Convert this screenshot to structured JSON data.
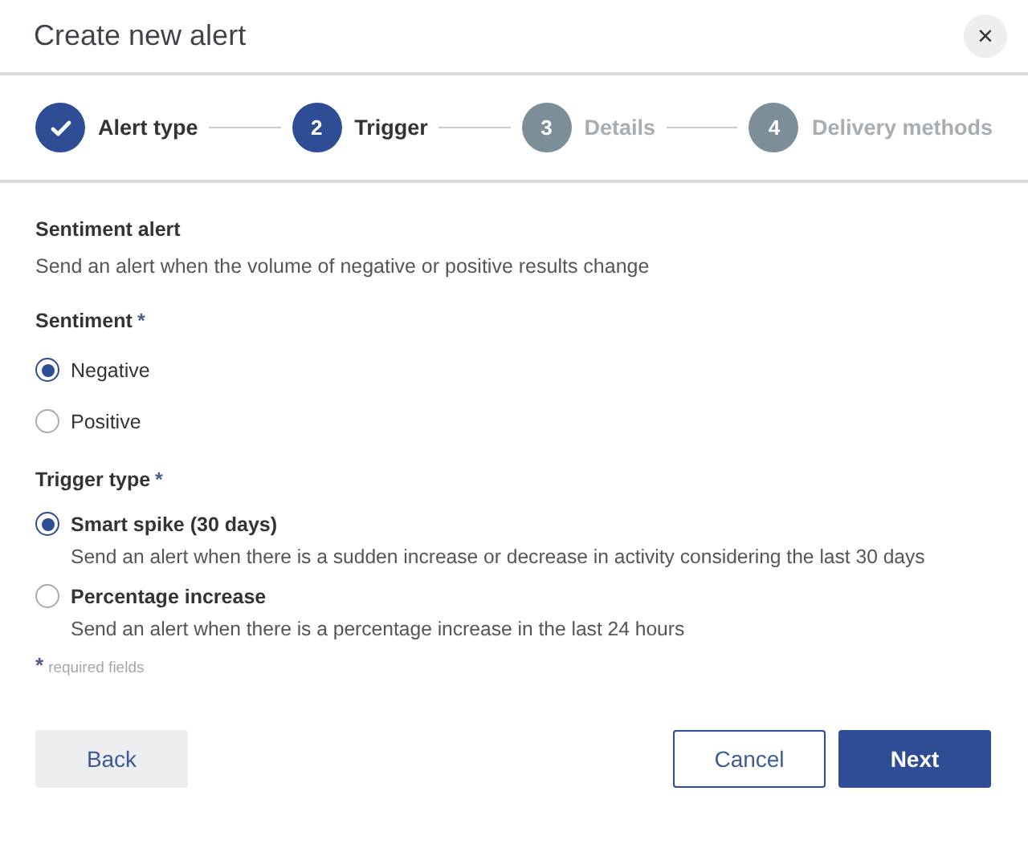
{
  "dialog": {
    "title": "Create new alert",
    "close": "×"
  },
  "steps": [
    {
      "kind": "done",
      "label": "Alert type"
    },
    {
      "kind": "active",
      "number": "2",
      "label": "Trigger"
    },
    {
      "kind": "pending",
      "number": "3",
      "label": "Details"
    },
    {
      "kind": "pending",
      "number": "4",
      "label": "Delivery methods"
    }
  ],
  "section": {
    "title": "Sentiment alert",
    "description": "Send an alert when the volume of negative or positive results change"
  },
  "sentiment": {
    "label": "Sentiment",
    "required_mark": "*",
    "options": [
      {
        "label": "Negative",
        "selected": true
      },
      {
        "label": "Positive",
        "selected": false
      }
    ]
  },
  "trigger_type": {
    "label": "Trigger type",
    "required_mark": "*",
    "options": [
      {
        "label": "Smart spike (30 days)",
        "description": "Send an alert when there is a sudden increase or decrease in activity considering the last 30 days",
        "selected": true
      },
      {
        "label": "Percentage increase",
        "description": "Send an alert when there is a percentage increase in the last 24 hours",
        "selected": false
      }
    ]
  },
  "required_note": {
    "mark": "*",
    "text": "required fields"
  },
  "buttons": {
    "back": "Back",
    "cancel": "Cancel",
    "next": "Next"
  }
}
